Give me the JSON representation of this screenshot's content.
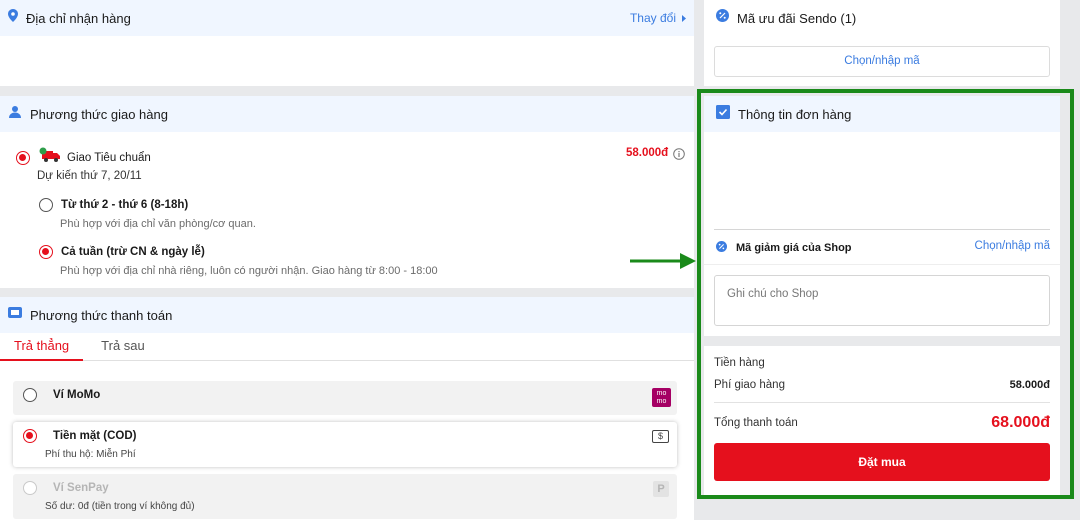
{
  "address": {
    "title": "Địa chỉ nhận hàng",
    "change_label": "Thay đổi"
  },
  "shipping": {
    "title": "Phương thức giao hàng",
    "method_name": "Giao Tiêu chuẩn",
    "method_price": "58.000đ",
    "eta": "Dự kiến thứ 7, 20/11",
    "options": [
      {
        "label": "Từ thứ 2 - thứ 6 (8-18h)",
        "desc": "Phù hợp với địa chỉ văn phòng/cơ quan.",
        "selected": false
      },
      {
        "label": "Cả tuần (trừ CN & ngày lễ)",
        "desc": "Phù hợp với địa chỉ nhà riêng, luôn có người nhận. Giao hàng từ 8:00 - 18:00",
        "selected": true
      }
    ]
  },
  "payment": {
    "title": "Phương thức thanh toán",
    "tabs": [
      "Trả thẳng",
      "Trả sau"
    ],
    "methods": [
      {
        "name": "Ví MoMo",
        "icon": "momo-icon",
        "icon_text": "mo mo"
      },
      {
        "name": "Tiền mặt (COD)",
        "sub": "Phí thu hộ: Miễn Phí",
        "icon": "cash-icon",
        "icon_text": "$"
      },
      {
        "name": "Ví SenPay",
        "sub": "Số dư: 0đ (tiền trong ví không đủ)",
        "icon": "senpay-icon",
        "icon_text": "P"
      }
    ]
  },
  "coupon": {
    "title": "Mã ưu đãi Sendo (1)",
    "button": "Chọn/nhập mã"
  },
  "order": {
    "title": "Thông tin đơn hàng",
    "shop_coupon_label": "Mã giảm giá của Shop",
    "shop_coupon_action": "Chọn/nhập mã",
    "note_placeholder": "Ghi chú cho Shop"
  },
  "summary": {
    "subtotal_label": "Tiền hàng",
    "shipping_label": "Phí giao hàng",
    "shipping_value": "58.000đ",
    "total_label": "Tổng thanh toán",
    "total_value": "68.000đ",
    "buy_label": "Đặt mua"
  },
  "colors": {
    "accent": "#e5101d",
    "link": "#3b7ce0",
    "highlight": "#1a8a1a",
    "momo": "#a50064"
  }
}
